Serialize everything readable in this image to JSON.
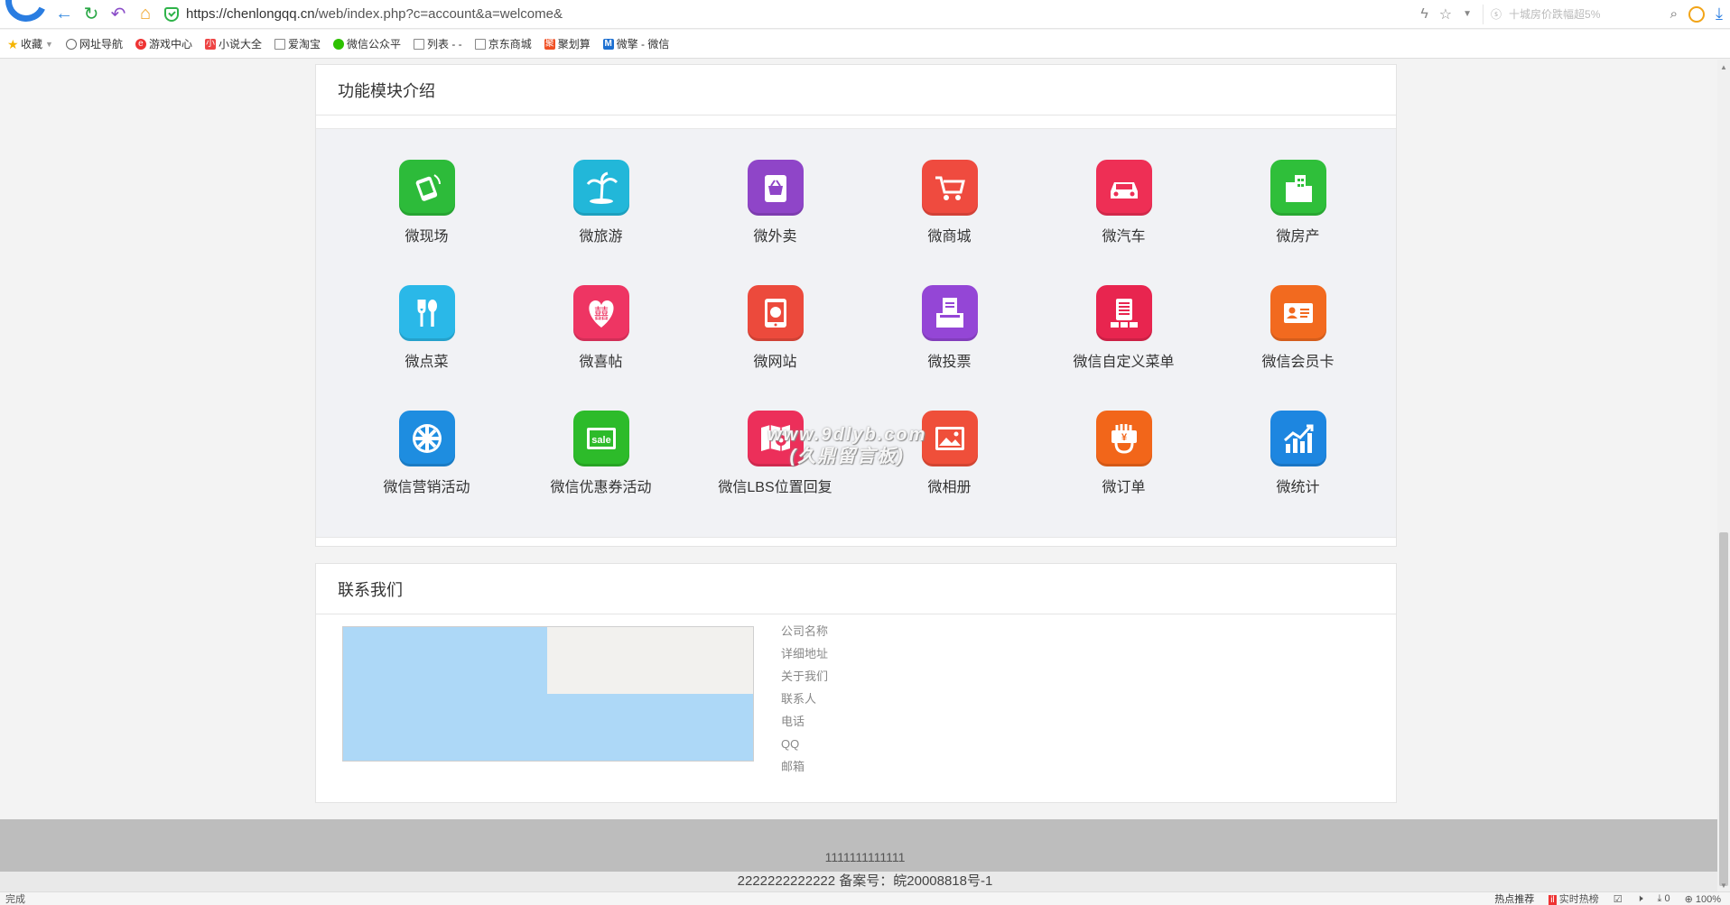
{
  "browser": {
    "url": "https://chenlongqq.cn/web/index.php?c=account&a=welcome&",
    "url_host": "https://chenlongqq.cn",
    "url_path": "/web/index.php?c=account&a=welcome&",
    "search_placeholder": "十城房价跌幅超5%",
    "bookmarks": [
      {
        "label": "收藏",
        "icon": "star-icon"
      },
      {
        "label": "网址导航",
        "icon": "globe-icon"
      },
      {
        "label": "游戏中心",
        "icon": "game-icon"
      },
      {
        "label": "小说大全",
        "icon": "book-icon"
      },
      {
        "label": "爱淘宝",
        "icon": "page-icon"
      },
      {
        "label": "微信公众平",
        "icon": "wechat-icon"
      },
      {
        "label": "列表 - -",
        "icon": "page-icon"
      },
      {
        "label": "京东商城",
        "icon": "page-icon"
      },
      {
        "label": "聚划算",
        "icon": "juhuasuan-icon"
      },
      {
        "label": "微擎 - 微信",
        "icon": "m-icon"
      }
    ]
  },
  "modules": {
    "title": "功能模块介绍",
    "items": [
      {
        "label": "微现场",
        "icon": "hands-phone-icon",
        "color": "#2dbb3a"
      },
      {
        "label": "微旅游",
        "icon": "palm-island-icon",
        "color": "#22b7d9"
      },
      {
        "label": "微外卖",
        "icon": "basket-icon",
        "color": "#8f45c8"
      },
      {
        "label": "微商城",
        "icon": "cart-icon",
        "color": "#ef4b3f"
      },
      {
        "label": "微汽车",
        "icon": "car-icon",
        "color": "#ee2f55"
      },
      {
        "label": "微房产",
        "icon": "buildings-icon",
        "color": "#2fbf3a"
      },
      {
        "label": "微点菜",
        "icon": "fork-spoon-icon",
        "color": "#2ab8e8"
      },
      {
        "label": "微喜帖",
        "icon": "double-happiness-icon",
        "color": "#ee3563"
      },
      {
        "label": "微网站",
        "icon": "tablet-globe-icon",
        "color": "#ec4a3c"
      },
      {
        "label": "微投票",
        "icon": "ballot-box-icon",
        "color": "#9446d6"
      },
      {
        "label": "微信自定义菜单",
        "icon": "menu-list-icon",
        "color": "#e8254f"
      },
      {
        "label": "微信会员卡",
        "icon": "member-card-icon",
        "color": "#f26a1f"
      },
      {
        "label": "微信营销活动",
        "icon": "wheel-icon",
        "color": "#1e8de0"
      },
      {
        "label": "微信优惠券活动",
        "icon": "sale-coupon-icon",
        "color": "#2dbb2a"
      },
      {
        "label": "微信LBS位置回复",
        "icon": "map-pin-icon",
        "color": "#ec2f5a"
      },
      {
        "label": "微相册",
        "icon": "photo-icon",
        "color": "#ef4f3a"
      },
      {
        "label": "微订单",
        "icon": "yuan-hand-icon",
        "color": "#f2661a"
      },
      {
        "label": "微统计",
        "icon": "chart-icon",
        "color": "#1d86e0"
      }
    ]
  },
  "watermark": {
    "line1": "www.9dlyb.com",
    "line2": "(久鼎留言板)"
  },
  "contact": {
    "title": "联系我们",
    "fields": [
      "公司名称",
      "详细地址",
      "关于我们",
      "联系人",
      "电话",
      "QQ",
      "邮箱"
    ]
  },
  "footer": {
    "line1": "1111111111111",
    "line2": "2222222222222 备案号：皖20008818号-1"
  },
  "status": {
    "left": "完成",
    "hot_recommend": "热点推荐",
    "realtime_hot": "实时热榜",
    "download_count": "0",
    "zoom": "100%"
  },
  "colors": {
    "accent": "#2a7de1",
    "footer_bg": "#bdbdbd",
    "modules_bg": "#f1f2f5"
  }
}
